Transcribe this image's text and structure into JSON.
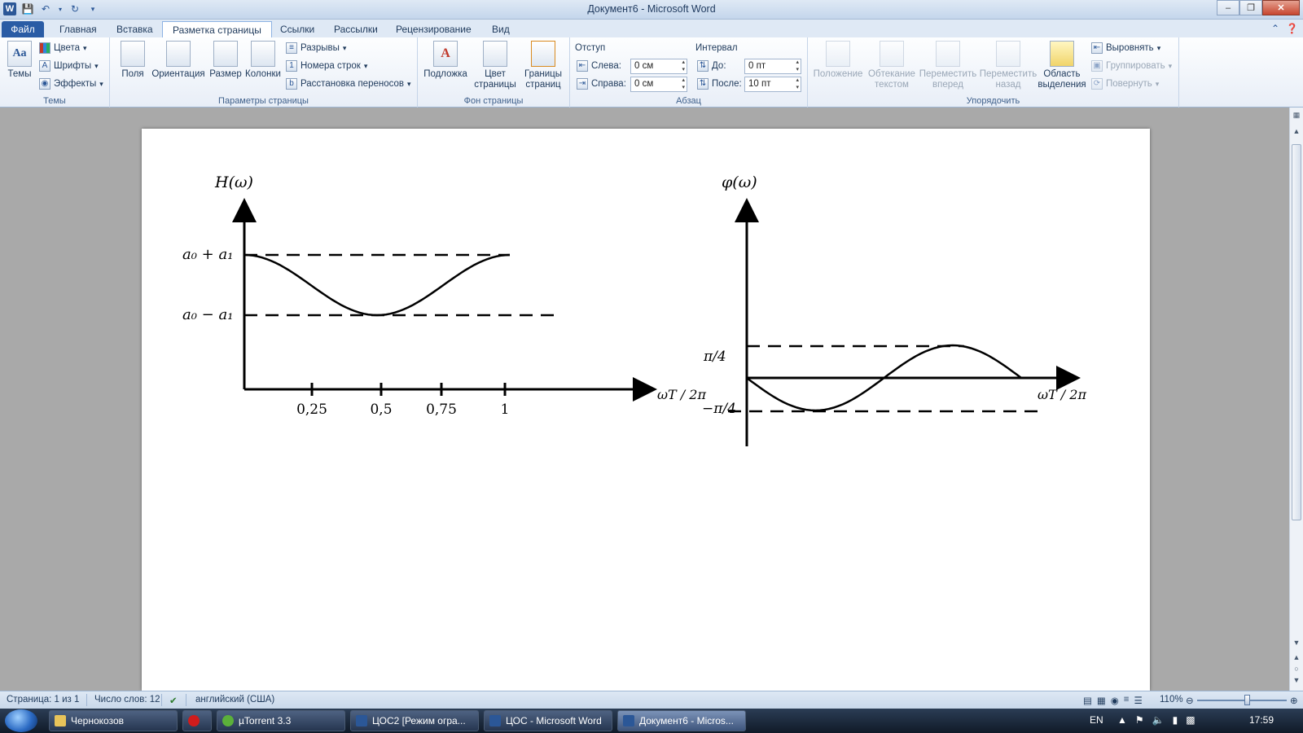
{
  "window": {
    "title": "Документ6  -  Microsoft Word",
    "quick_access": [
      "save-icon",
      "undo-icon",
      "redo-icon",
      "customize-icon"
    ]
  },
  "tabs": [
    {
      "label": "Файл"
    },
    {
      "label": "Главная"
    },
    {
      "label": "Вставка"
    },
    {
      "label": "Разметка страницы"
    },
    {
      "label": "Ссылки"
    },
    {
      "label": "Рассылки"
    },
    {
      "label": "Рецензирование"
    },
    {
      "label": "Вид"
    }
  ],
  "ribbon": {
    "themes": {
      "group_label": "Темы",
      "themes_btn": "Темы",
      "colors": "Цвета",
      "fonts": "Шрифты",
      "effects": "Эффекты"
    },
    "page_setup": {
      "group_label": "Параметры страницы",
      "margins": "Поля",
      "orientation": "Ориентация",
      "size": "Размер",
      "columns": "Колонки",
      "breaks": "Разрывы",
      "line_numbers": "Номера строк",
      "hyphenation": "Расстановка переносов"
    },
    "page_background": {
      "group_label": "Фон страницы",
      "watermark": "Подложка",
      "page_color_1": "Цвет",
      "page_color_2": "страницы",
      "page_borders_1": "Границы",
      "page_borders_2": "страниц"
    },
    "paragraph": {
      "group_label": "Абзац",
      "indent_label": "Отступ",
      "left_label": "Слева:",
      "left_value": "0 см",
      "right_label": "Справа:",
      "right_value": "0 см",
      "spacing_label": "Интервал",
      "before_label": "До:",
      "before_value": "0 пт",
      "after_label": "После:",
      "after_value": "10 пт"
    },
    "arrange": {
      "group_label": "Упорядочить",
      "position": "Положение",
      "wrap_1": "Обтекание",
      "wrap_2": "текстом",
      "forward_1": "Переместить",
      "forward_2": "вперед",
      "backward_1": "Переместить",
      "backward_2": "назад",
      "selection_1": "Область",
      "selection_2": "выделения",
      "align": "Выровнять",
      "group": "Группировать",
      "rotate": "Повернуть"
    }
  },
  "chart_data": [
    {
      "type": "line",
      "title": "H(ω)",
      "xlabel": "ωT / 2π",
      "ylabel": "H(ω)",
      "x_ticks": [
        "0,25",
        "0,5",
        "0,75",
        "1"
      ],
      "y_ticks": [
        "a₀ + a₁",
        "a₀ − a₁"
      ],
      "x": [
        0,
        0.125,
        0.25,
        0.375,
        0.5,
        0.625,
        0.75,
        0.875,
        1
      ],
      "series": [
        {
          "values": [
            1,
            0.854,
            0.5,
            0.146,
            0,
            0.146,
            0.5,
            0.854,
            1
          ]
        }
      ],
      "dashed_levels": [
        "a₀ + a₁",
        "a₀ − a₁"
      ]
    },
    {
      "type": "line",
      "title": "φ(ω)",
      "xlabel": "ωT / 2π",
      "ylabel": "φ(ω)",
      "y_ticks": [
        "π/4",
        "−π/4"
      ],
      "x": [
        0,
        0.25,
        0.5,
        0.75,
        1
      ],
      "series": [
        {
          "values": [
            0,
            -0.785,
            0,
            0.785,
            0
          ]
        }
      ],
      "dashed_levels": [
        "π/4",
        "−π/4"
      ]
    }
  ],
  "status": {
    "page": "Страница: 1 из 1",
    "words": "Число слов: 12",
    "language": "английский (США)",
    "zoom": "110%"
  },
  "taskbar": {
    "items": [
      {
        "label": "Чернокозов"
      },
      {
        "label": ""
      },
      {
        "label": "µTorrent 3.3"
      },
      {
        "label": "ЦОС2 [Режим огра..."
      },
      {
        "label": "ЦОС - Microsoft Word"
      },
      {
        "label": "Документ6 - Micros..."
      }
    ],
    "lang": "EN",
    "time": "17:59"
  }
}
